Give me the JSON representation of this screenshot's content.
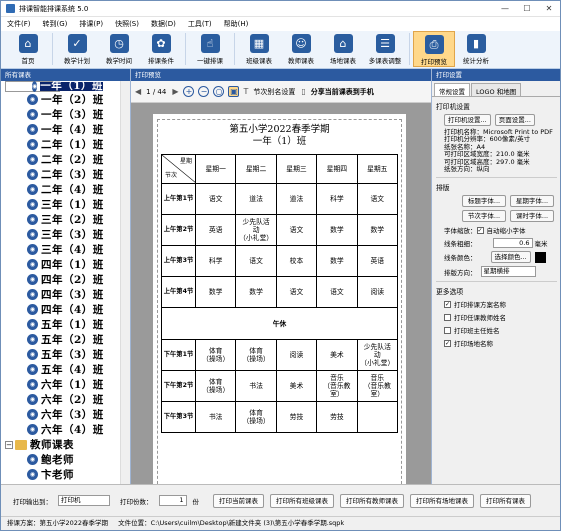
{
  "window": {
    "title": "排课智能排课系统 5.0",
    "min": "—",
    "max": "☐",
    "close": "✕"
  },
  "menu": [
    "文件(F)",
    "转到(G)",
    "排课(P)",
    "快照(S)",
    "数据(D)",
    "工具(T)",
    "帮助(H)"
  ],
  "toolbar": [
    {
      "label": "首页",
      "icon": "home-icon",
      "glyph": "⌂"
    },
    {
      "label": "教学计划",
      "icon": "clipboard-icon",
      "glyph": "✓"
    },
    {
      "label": "教学时间",
      "icon": "clock-icon",
      "glyph": "◷"
    },
    {
      "label": "排课条件",
      "icon": "conditions-icon",
      "glyph": "✿"
    },
    {
      "label": "一键排课",
      "icon": "hand-click-icon",
      "glyph": "☝"
    },
    {
      "label": "班级课表",
      "icon": "class-table-icon",
      "glyph": "▦"
    },
    {
      "label": "教师课表",
      "icon": "teacher-table-icon",
      "glyph": "☺"
    },
    {
      "label": "场地课表",
      "icon": "venue-table-icon",
      "glyph": "⌂"
    },
    {
      "label": "多课表调整",
      "icon": "multi-adjust-icon",
      "glyph": "☰"
    },
    {
      "label": "打印预览",
      "icon": "printer-icon",
      "glyph": "⎙"
    },
    {
      "label": "统计分析",
      "icon": "chart-icon",
      "glyph": "▮"
    }
  ],
  "left": {
    "header": "所有课表",
    "classes": [
      "一年（1）班",
      "一年（2）班",
      "一年（3）班",
      "一年（4）班",
      "二年（1）班",
      "二年（2）班",
      "二年（3）班",
      "二年（4）班",
      "三年（1）班",
      "三年（2）班",
      "三年（3）班",
      "三年（4）班",
      "四年（1）班",
      "四年（2）班",
      "四年（3）班",
      "四年（4）班",
      "五年（1）班",
      "五年（2）班",
      "五年（3）班",
      "五年（4）班",
      "六年（1）班",
      "六年（2）班",
      "六年（3）班",
      "六年（4）班"
    ],
    "teacher_group": "教师课表",
    "teachers": [
      "鲍老师",
      "卞老师"
    ]
  },
  "preview": {
    "header": "打印预览",
    "page": "1 / 44",
    "alias_btn": "节次别名设置",
    "share_btn": "分享当前课表到手机",
    "school_title": "第五小学2022春季学期",
    "class_title": "一年（1）班",
    "corner_top": "星期",
    "corner_bottom": "节次",
    "days": [
      "星期一",
      "星期二",
      "星期三",
      "星期四",
      "星期五"
    ],
    "periods": [
      {
        "label": "上午第1节",
        "cells": [
          "语文",
          "道法",
          "道法",
          "科学",
          "语文"
        ]
      },
      {
        "label": "上午第2节",
        "cells": [
          "英语",
          "少先队活\n动\n（小礼堂）",
          "语文",
          "数学",
          "数学"
        ]
      },
      {
        "label": "上午第3节",
        "cells": [
          "科学",
          "语文",
          "校本",
          "数学",
          "英语"
        ]
      },
      {
        "label": "上午第4节",
        "cells": [
          "数学",
          "数学",
          "语文",
          "语文",
          "阅读"
        ]
      }
    ],
    "noon": "午休",
    "afternoon": [
      {
        "label": "下午第1节",
        "cells": [
          "体育\n（操场）",
          "体育\n（操场）",
          "阅读",
          "美术",
          "少先队活\n动\n（小礼堂）"
        ]
      },
      {
        "label": "下午第2节",
        "cells": [
          "体育\n（操场）",
          "书法",
          "美术",
          "音乐\n（音乐教\n室）",
          "音乐\n（音乐教\n室）"
        ]
      },
      {
        "label": "下午第3节",
        "cells": [
          "书法",
          "体育\n（操场）",
          "劳技",
          "劳技",
          ""
        ]
      }
    ]
  },
  "settings": {
    "header": "打印设置",
    "tabs": [
      "常规设置",
      "LOGO 和地图"
    ],
    "printer_group": "打印机设置",
    "printer_btn": "打印机设置...",
    "page_btn": "页面设置...",
    "info": [
      "打印机名称：Microsoft Print to PDF",
      "打印机分辨率：600像素/英寸",
      "纸张名称：A4",
      "可打印区域宽度：210.0 毫米",
      "可打印区域高度：297.0 毫米",
      "纸张方向：纵向"
    ],
    "layout_group": "排版",
    "title_font": "标题字体...",
    "week_font": "星期字体...",
    "period_font": "节次字体...",
    "course_font": "课时字体...",
    "shrink_label": "字体缩放：",
    "auto_shrink": "自动缩小字体",
    "line_label": "线条粗细：",
    "line_value": "0.6",
    "line_unit": "毫米",
    "color_label": "线条颜色：",
    "color_btn": "选择颜色...",
    "dir_label": "排版方向：",
    "dir_value": "星期横排",
    "more_group": "更多选项",
    "options": [
      {
        "text": "打印排课方案名称",
        "checked": true
      },
      {
        "text": "打印任课教师姓名",
        "checked": false
      },
      {
        "text": "打印班主任姓名",
        "checked": false
      },
      {
        "text": "打印场地名称",
        "checked": true
      }
    ],
    "line_color": "#000000"
  },
  "bottom": {
    "output_label": "打印输出到：",
    "output_value": "打印机",
    "copies_label": "打印份数：",
    "copies_value": "1",
    "copies_unit": "份",
    "buttons": [
      "打印当前课表",
      "打印所有班级课表",
      "打印所有教师课表",
      "打印所有场地课表",
      "打印所有课表"
    ]
  },
  "status": {
    "plan_label": "排课方案：",
    "plan": "第五小学2022春季学期",
    "file_label": "文件位置：",
    "file": "C:\\Users\\cuilm\\Desktop\\新建文件夹 (3)\\第五小学春季学期.sqpk"
  }
}
